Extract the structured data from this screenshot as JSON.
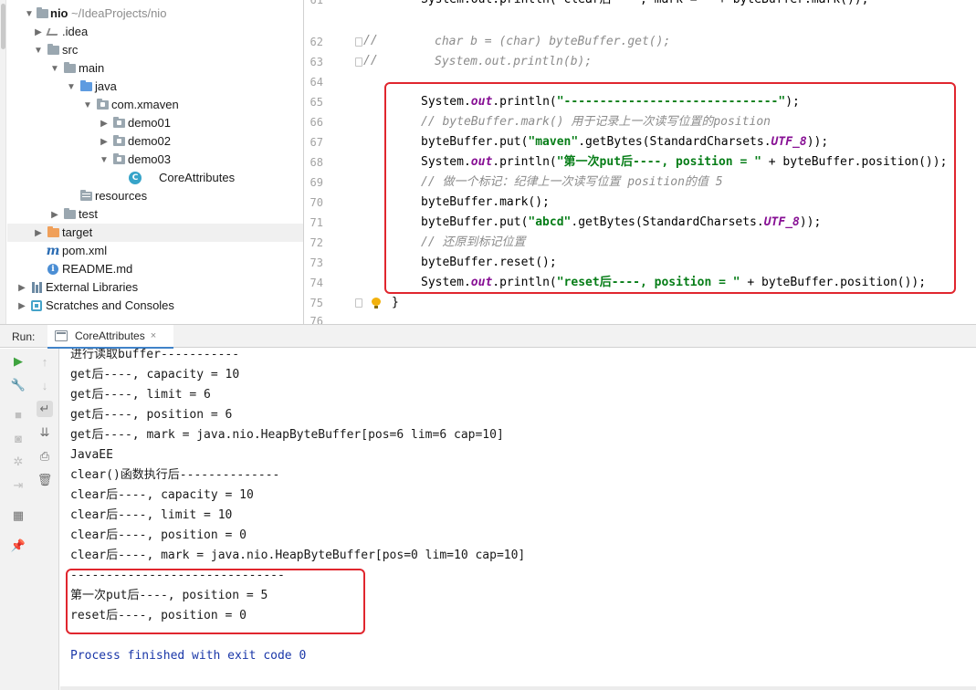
{
  "project_tree": {
    "root": {
      "name": "nio",
      "path": "~/IdeaProjects/nio"
    },
    "idea": ".idea",
    "src": "src",
    "main": "main",
    "java": "java",
    "package": "com.xmaven",
    "demo01": "demo01",
    "demo02": "demo02",
    "demo03": "demo03",
    "class_file": "CoreAttributes",
    "resources": "resources",
    "test": "test",
    "target": "target",
    "pom": "pom.xml",
    "readme": "README.md",
    "external_libraries": "External Libraries",
    "scratches": "Scratches and Consoles"
  },
  "editor": {
    "line_numbers": [
      "61",
      "62",
      "63",
      "64",
      "65",
      "66",
      "67",
      "68",
      "69",
      "70",
      "71",
      "72",
      "73",
      "74",
      "75",
      "76"
    ],
    "line61_partial": "System.out.println(\"clear后----, mark = \" + byteBuffer.mark());",
    "line62": {
      "slashes": "//",
      "code": "char b = (char) byteBuffer.get();"
    },
    "line63": {
      "slashes": "//",
      "code": "System.out.println(b);"
    },
    "line65": {
      "recv": "System.",
      "field": "out",
      "call": ".println(",
      "str": "\"------------------------------\"",
      "end": ");"
    },
    "line66": "// byteBuffer.mark() 用于记录上一次读写位置的position",
    "line67": {
      "a": "byteBuffer.put(",
      "str": "\"maven\"",
      "b": ".getBytes(",
      "c": "StandardCharsets.",
      "cst": "UTF_8",
      "end": "));"
    },
    "line68": {
      "recv": "System.",
      "field": "out",
      "call": ".println(",
      "str": "\"第一次put后----, position = \"",
      "rest": " + byteBuffer.position());"
    },
    "line69": "// 做一个标记：纪律上一次读写位置 position的值 5",
    "line70": "byteBuffer.mark();",
    "line71": {
      "a": "byteBuffer.put(",
      "str": "\"abcd\"",
      "b": ".getBytes(",
      "c": "StandardCharsets.",
      "cst": "UTF_8",
      "end": "));"
    },
    "line72": "// 还原到标记位置",
    "line73": "byteBuffer.reset();",
    "line74": {
      "recv": "System.",
      "field": "out",
      "call": ".println(",
      "str": "\"reset后----, position = \"",
      "rest": " + byteBuffer.position());"
    },
    "line75": "}"
  },
  "run_panel": {
    "label": "Run:",
    "tab_label": "CoreAttributes",
    "tab_close": "×"
  },
  "console": {
    "lines": [
      "进行读取buffer-----------",
      "get后----, capacity = 10",
      "get后----, limit = 6",
      "get后----, position = 6",
      "get后----, mark = java.nio.HeapByteBuffer[pos=6 lim=6 cap=10]",
      "JavaEE",
      "clear()函数执行后--------------",
      "clear后----, capacity = 10",
      "clear后----, limit = 10",
      "clear后----, position = 0",
      "clear后----, mark = java.nio.HeapByteBuffer[pos=0 lim=10 cap=10]",
      "------------------------------",
      "第一次put后----, position = 5",
      "reset后----, position = 0",
      "",
      "Process finished with exit code 0"
    ]
  },
  "colors": {
    "highlight_box": "#e0262e",
    "string": "#067d17",
    "field": "#871094",
    "comment": "#8c8c8c",
    "exit_message": "#1a37a8"
  }
}
